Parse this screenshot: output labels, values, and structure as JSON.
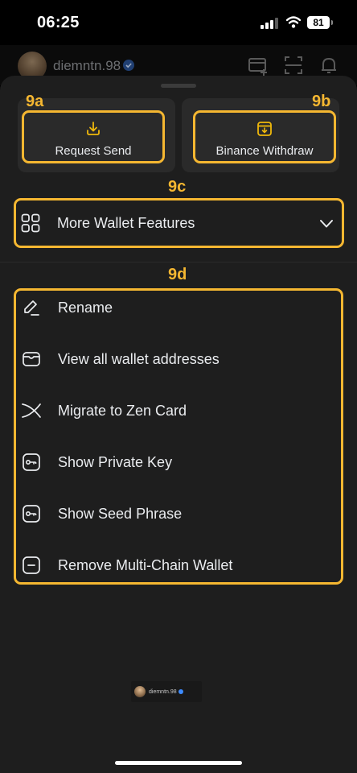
{
  "status_bar": {
    "time": "06:25",
    "battery": "81"
  },
  "header": {
    "username": "diemntn.98",
    "icons": [
      "avatar",
      "verified-badge-icon",
      "add-card-icon",
      "scan-icon",
      "bell-icon"
    ]
  },
  "annotation_tags": {
    "a": "9a",
    "b": "9b",
    "c": "9c",
    "d": "9d"
  },
  "actions": {
    "request_send": {
      "label": "Request Send",
      "icon": "download-icon"
    },
    "binance_withdraw": {
      "label": "Binance Withdraw",
      "icon": "withdraw-icon"
    }
  },
  "more_features": {
    "label": "More Wallet Features",
    "icon": "grid-icon",
    "state_icon": "chevron-down-icon"
  },
  "menu": {
    "items": [
      {
        "label": "Rename",
        "icon": "pencil-icon"
      },
      {
        "label": "View all wallet addresses",
        "icon": "wallet-icon"
      },
      {
        "label": "Migrate to Zen Card",
        "icon": "zen-icon"
      },
      {
        "label": "Show Private Key",
        "icon": "key-icon"
      },
      {
        "label": "Show Seed Phrase",
        "icon": "key-icon"
      },
      {
        "label": "Remove Multi-Chain Wallet",
        "icon": "minus-square-icon"
      }
    ]
  },
  "watermark": {
    "username": "diemntn.98"
  },
  "colors": {
    "sheet_background": "#1e1e1e",
    "card_background": "#2a2a2a",
    "highlight": "#f5b731",
    "text_primary": "#eaecef",
    "verified_blue": "#3d8bff"
  }
}
